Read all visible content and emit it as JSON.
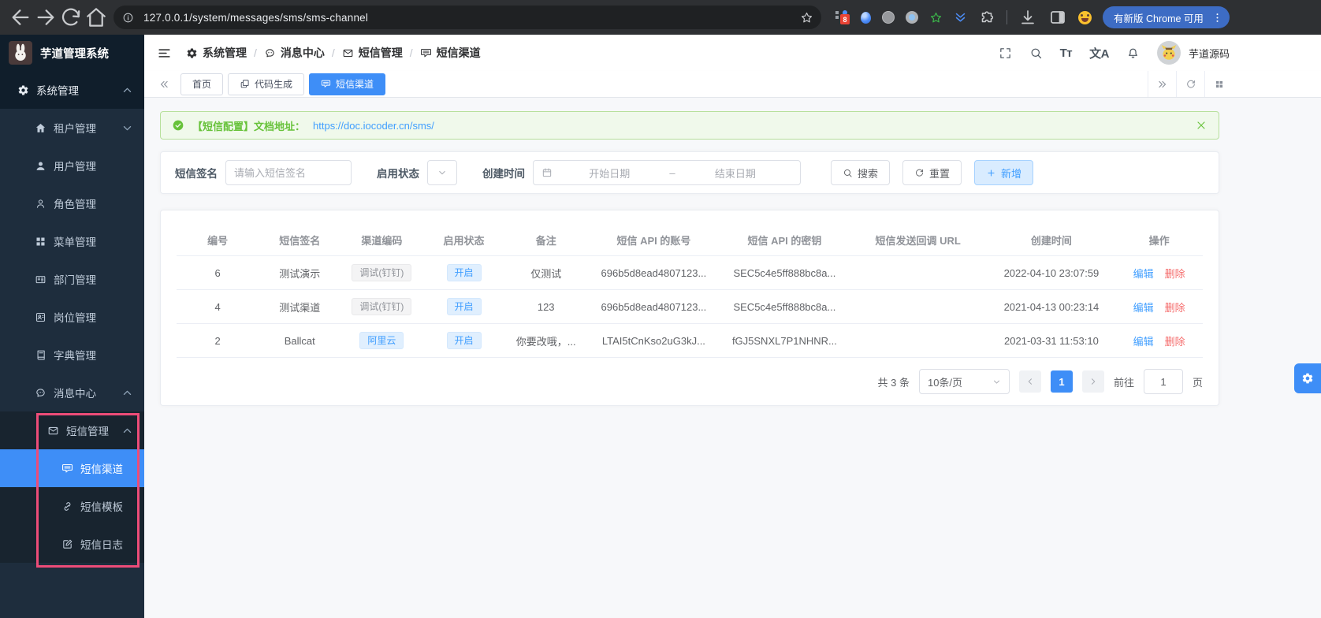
{
  "colors": {
    "accent": "#409eff",
    "success": "#67c23a",
    "danger": "#f56c6c",
    "annotation": "#ed4c78",
    "sidebar_bg": "#1e2d3d"
  },
  "browser": {
    "url": "127.0.0.1/system/messages/sms/sms-channel",
    "update_button": "有新版 Chrome 可用"
  },
  "sidebar": {
    "logo_title": "芋道管理系统",
    "items": [
      {
        "key": "system",
        "label": "系统管理",
        "icon": "gear",
        "level": 0,
        "chevron": "up",
        "band": true
      },
      {
        "key": "tenant",
        "label": "租户管理",
        "icon": "house",
        "level": 1,
        "chevron": "down"
      },
      {
        "key": "user",
        "label": "用户管理",
        "icon": "user",
        "level": 1
      },
      {
        "key": "role",
        "label": "角色管理",
        "icon": "person",
        "level": 1
      },
      {
        "key": "menu",
        "label": "菜单管理",
        "icon": "grid",
        "level": 1
      },
      {
        "key": "dept",
        "label": "部门管理",
        "icon": "dept",
        "level": 1
      },
      {
        "key": "post",
        "label": "岗位管理",
        "icon": "post",
        "level": 1
      },
      {
        "key": "dict",
        "label": "字典管理",
        "icon": "dict",
        "level": 1
      },
      {
        "key": "message-center",
        "label": "消息中心",
        "icon": "comment",
        "level": 1,
        "chevron": "up"
      },
      {
        "key": "sms-management",
        "label": "短信管理",
        "icon": "mail",
        "level": 2,
        "chevron": "up",
        "dark": true
      },
      {
        "key": "sms-channel",
        "label": "短信渠道",
        "icon": "sms",
        "level": 3,
        "active": true,
        "dark": true
      },
      {
        "key": "sms-template",
        "label": "短信模板",
        "icon": "template",
        "level": 3,
        "dark": true
      },
      {
        "key": "sms-log",
        "label": "短信日志",
        "icon": "log",
        "level": 3,
        "dark": true
      }
    ]
  },
  "header": {
    "breadcrumb": [
      {
        "label": "系统管理",
        "icon": "gear"
      },
      {
        "label": "消息中心",
        "icon": "comment"
      },
      {
        "label": "短信管理",
        "icon": "mail"
      },
      {
        "label": "短信渠道",
        "icon": "sms"
      }
    ],
    "breadcrumb_sep": "/",
    "font_size_icon_text": "Tт",
    "translate_icon_text": "文A",
    "username": "芋道源码"
  },
  "tabs": [
    {
      "key": "home",
      "label": "首页"
    },
    {
      "key": "codegen",
      "label": "代码生成",
      "icon": "copy"
    },
    {
      "key": "sms-channel",
      "label": "短信渠道",
      "icon": "sms",
      "active": true
    }
  ],
  "alert": {
    "text": "【短信配置】文档地址：",
    "link": "https://doc.iocoder.cn/sms/"
  },
  "filters": {
    "sign_label": "短信签名",
    "sign_placeholder": "请输入短信签名",
    "status_label": "启用状态",
    "date_label": "创建时间",
    "date_start_placeholder": "开始日期",
    "date_separator": "–",
    "date_end_placeholder": "结束日期",
    "search_button": "搜索",
    "reset_button": "重置",
    "add_button": "新增"
  },
  "table": {
    "columns": [
      {
        "key": "id",
        "label": "编号",
        "w": "8%"
      },
      {
        "key": "sign",
        "label": "短信签名",
        "w": "8%"
      },
      {
        "key": "code",
        "label": "渠道编码",
        "w": "8%"
      },
      {
        "key": "status",
        "label": "启用状态",
        "w": "8%"
      },
      {
        "key": "remark",
        "label": "备注",
        "w": "8%"
      },
      {
        "key": "api_key",
        "label": "短信 API 的账号",
        "w": "13%"
      },
      {
        "key": "api_secret",
        "label": "短信 API 的密钥",
        "w": "12.5%"
      },
      {
        "key": "callback",
        "label": "短信发送回调 URL",
        "w": "13.5%"
      },
      {
        "key": "created",
        "label": "创建时间",
        "w": "12.5%"
      },
      {
        "key": "ops",
        "label": "操作",
        "w": "8.5%"
      }
    ],
    "rows": [
      {
        "id": "6",
        "sign": "测试演示",
        "code": "调试(钉钉)",
        "code_type": "info",
        "status": "开启",
        "remark": "仅测试",
        "api_key": "696b5d8ead4807123...",
        "api_secret": "SEC5c4e5ff888bc8a...",
        "callback": "",
        "created": "2022-04-10 23:07:59"
      },
      {
        "id": "4",
        "sign": "测试渠道",
        "code": "调试(钉钉)",
        "code_type": "info",
        "status": "开启",
        "remark": "123",
        "api_key": "696b5d8ead4807123...",
        "api_secret": "SEC5c4e5ff888bc8a...",
        "callback": "",
        "created": "2021-04-13 00:23:14"
      },
      {
        "id": "2",
        "sign": "Ballcat",
        "code": "阿里云",
        "code_type": "primary",
        "status": "开启",
        "remark": "你要改哦，...",
        "api_key": "LTAI5tCnKso2uG3kJ...",
        "api_secret": "fGJ5SNXL7P1NHNR...",
        "callback": "",
        "created": "2021-03-31 11:53:10"
      }
    ],
    "edit_label": "编辑",
    "delete_label": "删除"
  },
  "pagination": {
    "total": "共 3 条",
    "page_size": "10条/页",
    "current_page": "1",
    "goto_label": "前往",
    "goto_value": "1",
    "page_unit": "页"
  }
}
